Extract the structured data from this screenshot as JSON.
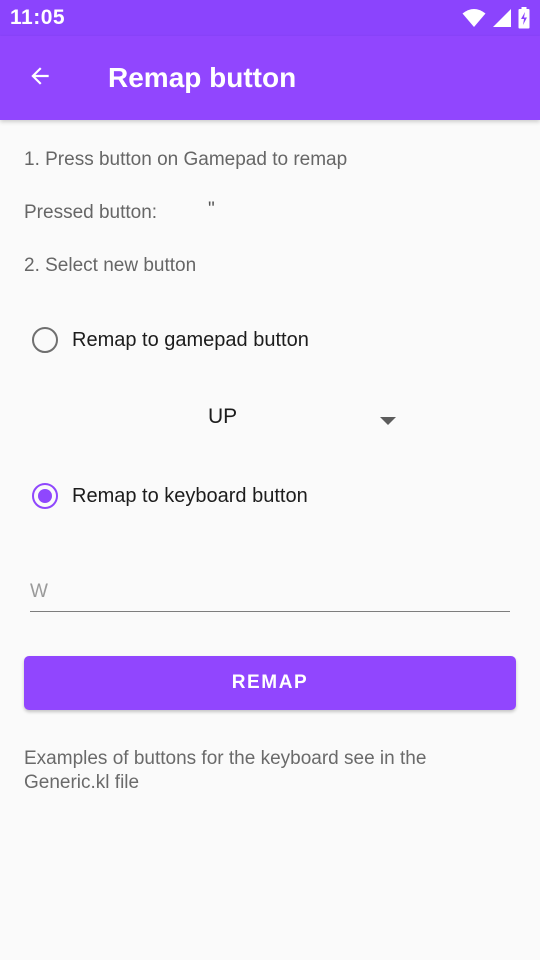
{
  "status_bar": {
    "time": "11:05",
    "icons": [
      "wifi-icon",
      "cellular-signal-icon",
      "battery-charging-icon"
    ]
  },
  "app_bar": {
    "title": "Remap button",
    "back_icon": "arrow-back-icon"
  },
  "main": {
    "step1": "1. Press button on Gamepad to remap",
    "pressed_label": "Pressed button:",
    "pressed_value": "\"",
    "step2": "2. Select new button",
    "gamepad_option": {
      "label": "Remap to gamepad button",
      "checked": false
    },
    "gamepad_spinner": {
      "selected": "UP"
    },
    "keyboard_option": {
      "label": "Remap to keyboard button",
      "checked": true
    },
    "keyboard_input": {
      "value": "",
      "placeholder": "W"
    },
    "remap_button_label": "REMAP",
    "hint": "Examples of buttons for the keyboard see in the Generic.kl file"
  },
  "colors": {
    "primary": "#9146fe",
    "status_bar": "#8b44fd",
    "background": "#fafafa"
  }
}
